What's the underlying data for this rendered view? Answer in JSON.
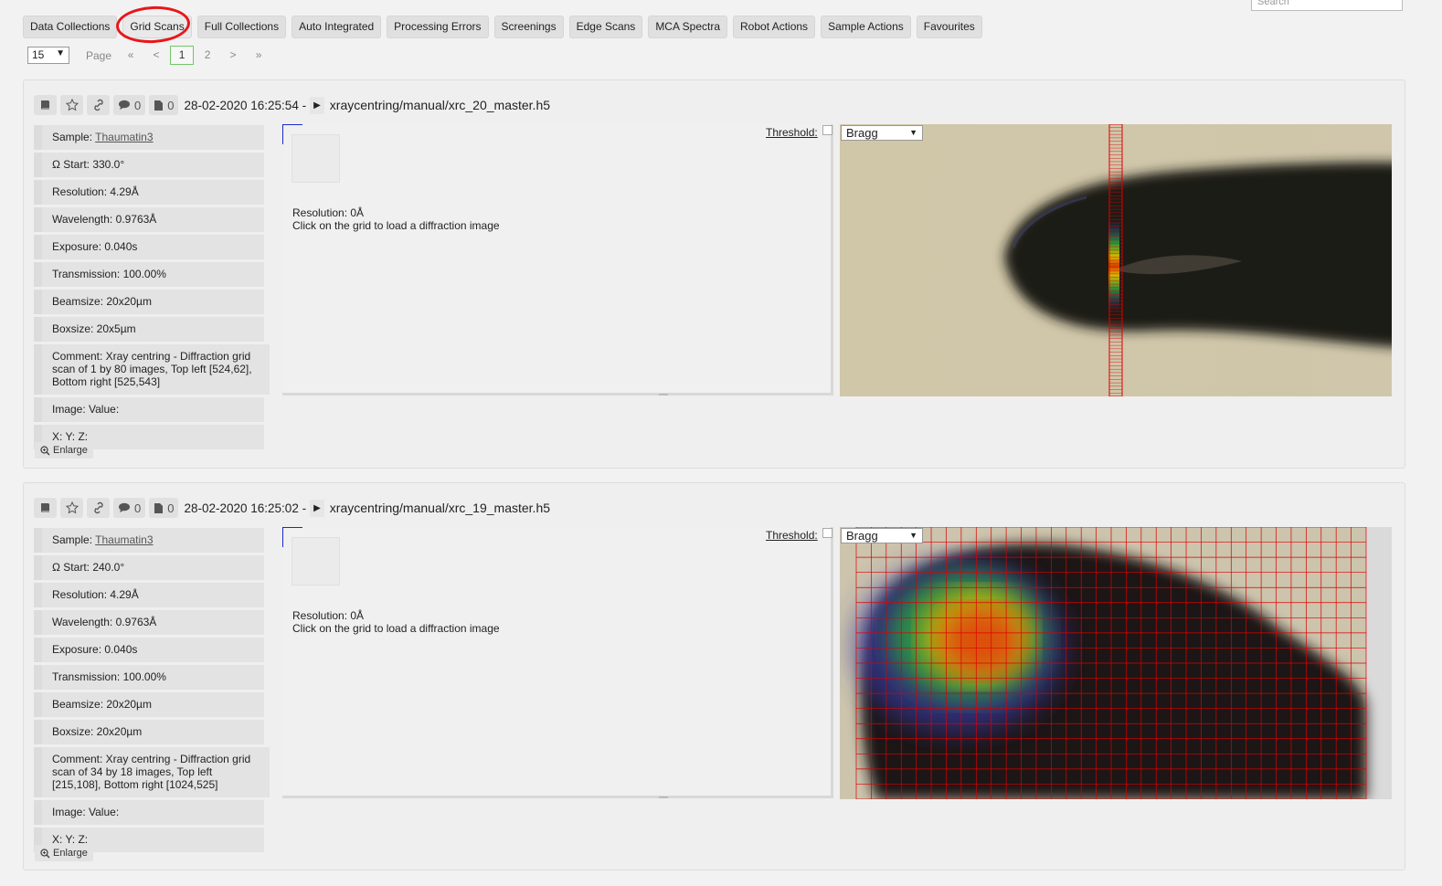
{
  "search": {
    "placeholder": "Search"
  },
  "tabs": [
    {
      "label": "Data Collections"
    },
    {
      "label": "Grid Scans"
    },
    {
      "label": "Full Collections"
    },
    {
      "label": "Auto Integrated"
    },
    {
      "label": "Processing Errors"
    },
    {
      "label": "Screenings"
    },
    {
      "label": "Edge Scans"
    },
    {
      "label": "MCA Spectra"
    },
    {
      "label": "Robot Actions"
    },
    {
      "label": "Sample Actions"
    },
    {
      "label": "Favourites"
    }
  ],
  "pager": {
    "page_size": "15",
    "page_label": "Page",
    "first": "«",
    "prev": "<",
    "pages": [
      "1",
      "2"
    ],
    "next": ">",
    "last": "»"
  },
  "panels": [
    {
      "comments": "0",
      "files": "0",
      "date": "28-02-2020 16:25:54 -",
      "file": "xraycentring/manual/xrc_20_master.h5",
      "sample_label": "Sample:",
      "sample": "Thaumatin3",
      "omega": "Ω Start: 330.0°",
      "resolution": "Resolution: 4.29Å",
      "wavelength": "Wavelength: 0.9763Å",
      "exposure": "Exposure: 0.040s",
      "transmission": "Transmission: 100.00%",
      "beamsize": "Beamsize: 20x20µm",
      "boxsize": "Boxsize: 20x5µm",
      "comment": "Comment: Xray centring - Diffraction grid scan of 1 by 80 images, Top left [524,62], Bottom right [525,543]",
      "image_value": "Image: Value:",
      "xyz": "X: Y: Z:",
      "enlarge": "Enlarge",
      "diff_resolution": "Resolution: 0Å",
      "diff_hint": "Click on the grid to load a diffraction image",
      "threshold": "Threshold:",
      "mode": "Bragg"
    },
    {
      "comments": "0",
      "files": "0",
      "date": "28-02-2020 16:25:02 -",
      "file": "xraycentring/manual/xrc_19_master.h5",
      "sample_label": "Sample:",
      "sample": "Thaumatin3",
      "omega": "Ω Start: 240.0°",
      "resolution": "Resolution: 4.29Å",
      "wavelength": "Wavelength: 0.9763Å",
      "exposure": "Exposure: 0.040s",
      "transmission": "Transmission: 100.00%",
      "beamsize": "Beamsize: 20x20µm",
      "boxsize": "Boxsize: 20x20µm",
      "comment": "Comment: Xray centring - Diffraction grid scan of 34 by 18 images, Top left [215,108], Bottom right [1024,525]",
      "image_value": "Image: Value:",
      "xyz": "X: Y: Z:",
      "enlarge": "Enlarge",
      "diff_resolution": "Resolution: 0Å",
      "diff_hint": "Click on the grid to load a diffraction image",
      "threshold": "Threshold:",
      "mode": "Bragg"
    }
  ],
  "colors": {
    "accent_green": "#73c56b",
    "annotation_red": "#e8161a",
    "grid_red": "#dd0000"
  }
}
